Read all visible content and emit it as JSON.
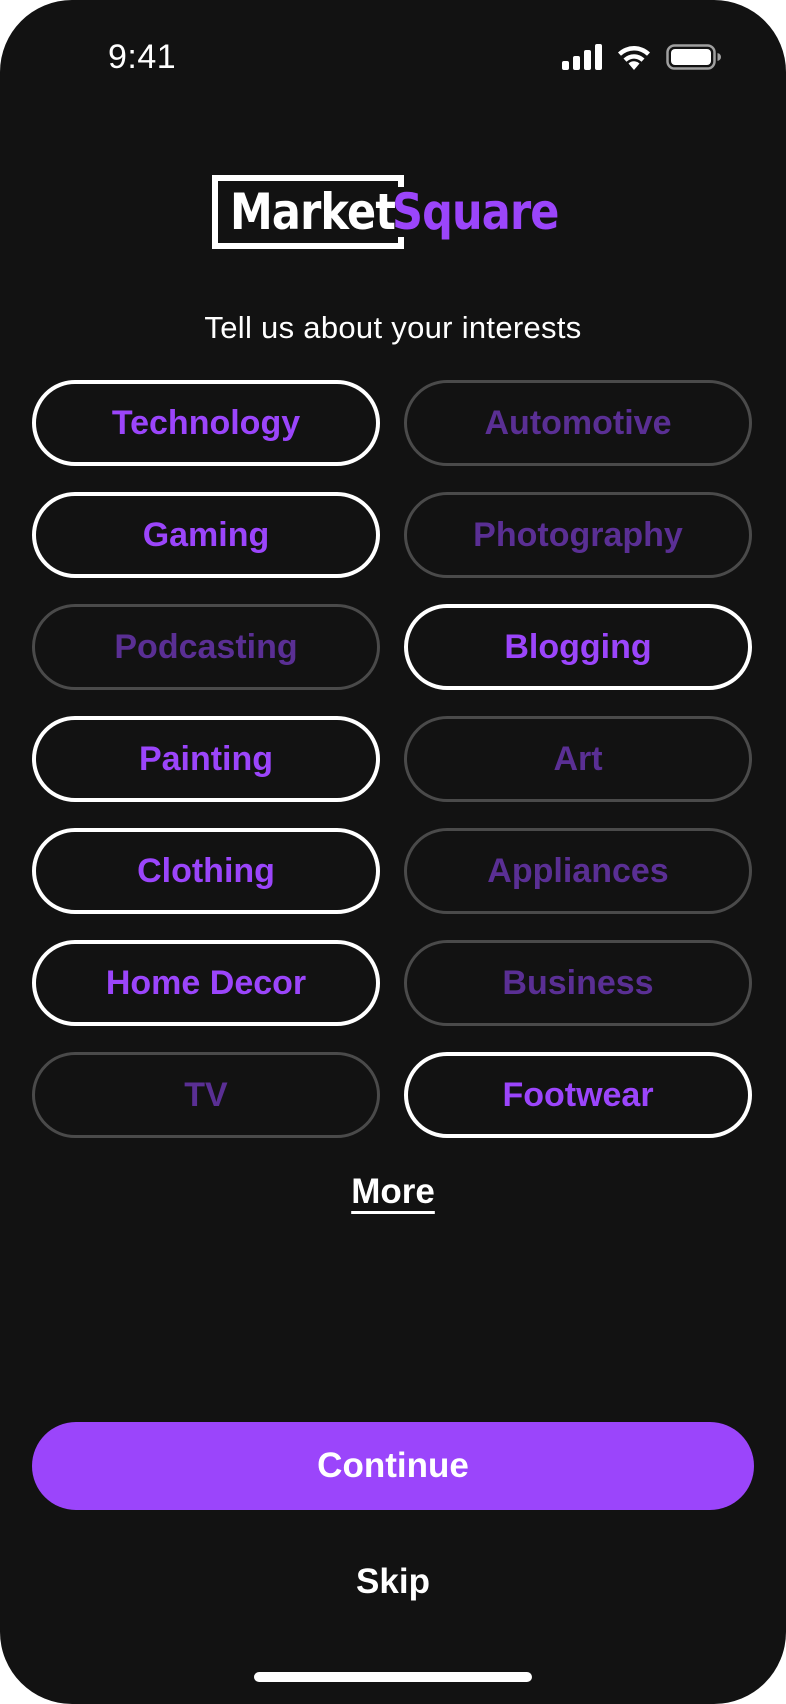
{
  "status_bar": {
    "time": "9:41",
    "icons": [
      "cellular-signal-icon",
      "wifi-icon",
      "battery-icon"
    ]
  },
  "logo": {
    "part1": "Market",
    "part2": "Square"
  },
  "subtitle": "Tell us about your interests",
  "interests": [
    {
      "label": "Technology",
      "selected": true
    },
    {
      "label": "Automotive",
      "selected": false
    },
    {
      "label": "Gaming",
      "selected": true
    },
    {
      "label": "Photography",
      "selected": false
    },
    {
      "label": "Podcasting",
      "selected": false
    },
    {
      "label": "Blogging",
      "selected": true
    },
    {
      "label": "Painting",
      "selected": true
    },
    {
      "label": "Art",
      "selected": false
    },
    {
      "label": "Clothing",
      "selected": true
    },
    {
      "label": "Appliances",
      "selected": false
    },
    {
      "label": "Home Decor",
      "selected": true
    },
    {
      "label": "Business",
      "selected": false
    },
    {
      "label": "TV",
      "selected": false
    },
    {
      "label": "Footwear",
      "selected": true
    }
  ],
  "more_label": "More",
  "continue_label": "Continue",
  "skip_label": "Skip",
  "colors": {
    "background": "#121212",
    "accent": "#9b45fb",
    "accent_dim": "#5a2f94",
    "text": "#ffffff"
  }
}
